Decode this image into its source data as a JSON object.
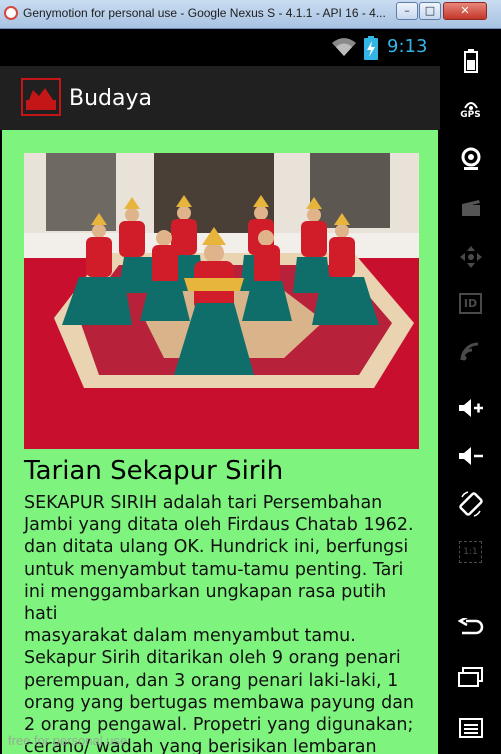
{
  "window": {
    "title": "Genymotion for personal use - Google Nexus S - 4.1.1 - API 16 - 4...",
    "minimize_label": "–",
    "maximize_label": "□",
    "close_label": "✕"
  },
  "status_bar": {
    "time": "9:13"
  },
  "action_bar": {
    "title": "Budaya"
  },
  "article": {
    "title": "Tarian Sekapur Sirih",
    "body": "SEKAPUR SIRIH adalah tari Persembahan\nJambi yang ditata oleh Firdaus Chatab 1962.\ndan ditata ulang OK. Hundrick ini,  berfungsi\nuntuk menyambut tamu-tamu penting. Tari\nini menggambarkan ungkapan rasa putih hati\nmasyarakat dalam menyambut tamu.\nSekapur Sirih ditarikan oleh 9 orang penari\nperempuan, dan 3 orang penari laki-laki, 1\norang  yang bertugas membawa payung dan\n2 orang pengawal. Propetri yang digunakan;\ncerano/ wadah yang berisikan lembaran"
  },
  "watermark": "free for personal use",
  "toolbar": {
    "icons": [
      "battery-icon",
      "gps-icon",
      "camera-icon",
      "video-icon",
      "dpad-icon",
      "id-icon",
      "broadcast-icon",
      "volume-up-icon",
      "volume-down-icon",
      "rotate-icon",
      "scale-icon",
      "back-icon",
      "recent-apps-icon",
      "menu-icon"
    ],
    "gps_label": "GPS",
    "id_label": "ID",
    "scale_label": "1:1"
  },
  "colors": {
    "content_bg": "#7ef47e",
    "accent_blue": "#33b5e5",
    "action_bar_bg": "#202020"
  }
}
